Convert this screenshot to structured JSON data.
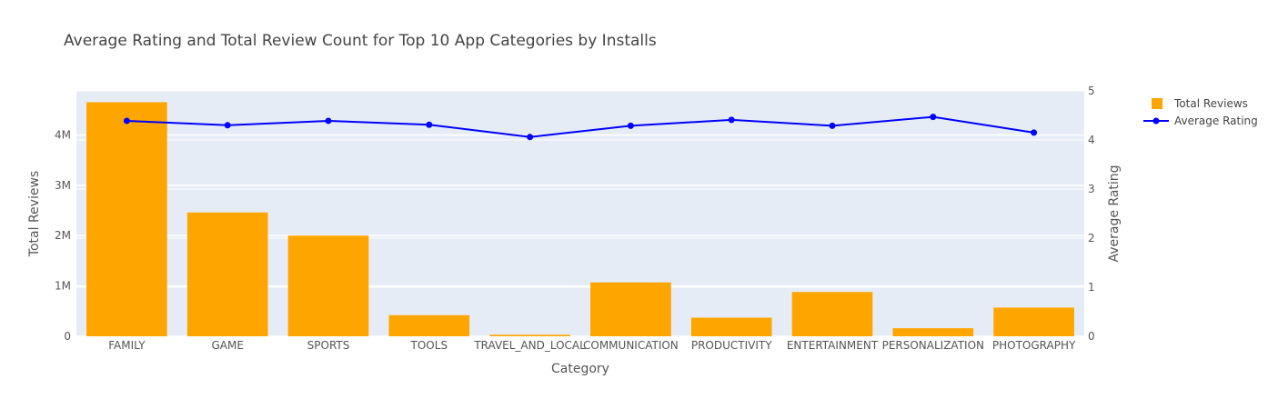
{
  "chart_data": {
    "type": "bar",
    "title": "Average Rating and Total Review Count for Top 10 App Categories by Installs",
    "xlabel": "Category",
    "ylabel": "Total Reviews",
    "y2label": "Average Rating",
    "categories": [
      "FAMILY",
      "GAME",
      "SPORTS",
      "TOOLS",
      "TRAVEL_AND_LOCAL",
      "COMMUNICATION",
      "PRODUCTIVITY",
      "ENTERTAINMENT",
      "PERSONALIZATION",
      "PHOTOGRAPHY"
    ],
    "series": [
      {
        "name": "Total Reviews",
        "type": "bar",
        "axis": "left",
        "color": "#FFA500",
        "values": [
          4650000,
          2460000,
          2000000,
          420000,
          30000,
          1070000,
          370000,
          880000,
          160000,
          570000
        ]
      },
      {
        "name": "Average Rating",
        "type": "line",
        "axis": "right",
        "color": "#0000FF",
        "values": [
          4.39,
          4.3,
          4.39,
          4.31,
          4.06,
          4.29,
          4.41,
          4.29,
          4.47,
          4.15
        ]
      }
    ],
    "ylim": [
      0,
      4875000
    ],
    "y2lim": [
      0,
      5
    ],
    "yticks": [
      0,
      1000000,
      2000000,
      3000000,
      4000000
    ],
    "ytick_labels": [
      "0",
      "1M",
      "2M",
      "3M",
      "4M"
    ],
    "y2ticks": [
      0,
      1,
      2,
      3,
      4,
      5
    ],
    "y2tick_labels": [
      "0",
      "1",
      "2",
      "3",
      "4",
      "5"
    ],
    "grid": true,
    "legend": "top-right",
    "plot_background": "#E5ECF6"
  }
}
